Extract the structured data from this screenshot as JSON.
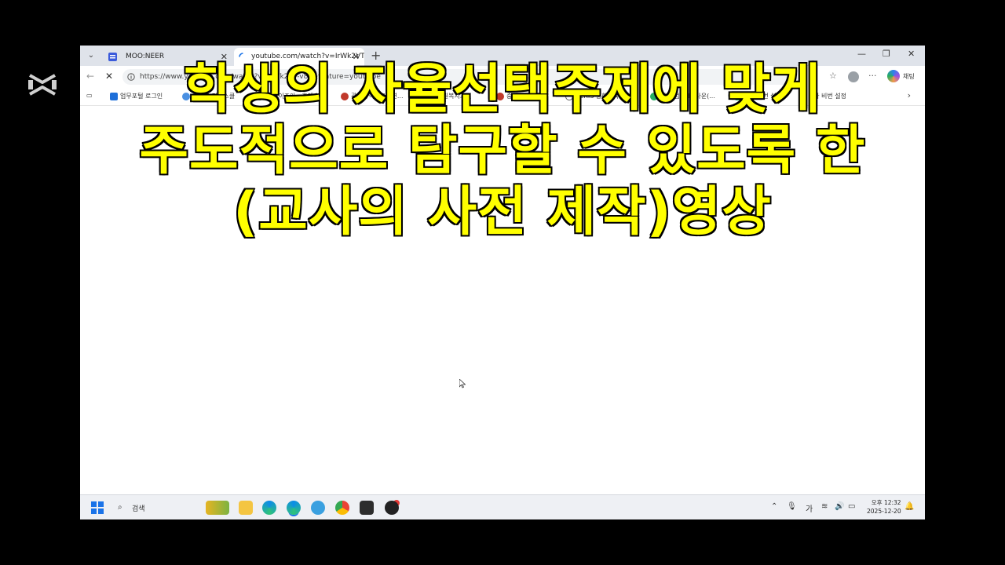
{
  "browser": {
    "tabs": [
      {
        "title": "MOO:NEER",
        "active": false
      },
      {
        "title": "youtube.com/watch?v=IrWk2VT-v",
        "active": true
      }
    ],
    "url": "https://www.youtube.com/watch?v=IrWk2VT-v8g&feature=youtu.be",
    "copilot_label": "채팅",
    "bookmarks": [
      {
        "label": "업무포털 로그인",
        "color": "#1e6fd9"
      },
      {
        "label": "운남고 리로스쿨",
        "color": "#4a90e2"
      },
      {
        "label": "㈜컴이조아 - 홈페...",
        "color": "#666666"
      },
      {
        "label": "광주광역시교육연...",
        "color": "#c0392b"
      },
      {
        "label": "공무원복지포털",
        "color": "#e74c3c"
      },
      {
        "label": "중앙교육연수원",
        "color": "#c0392b"
      },
      {
        "label": "KERIS 종합교육연...",
        "color": "#666666"
      },
      {
        "label": "첫 수업 자료 다운(...",
        "color": "#27ae60"
      },
      {
        "label": "2차 비번 설정",
        "color": "#2ecc71"
      },
      {
        "label": "1차 비번 설정",
        "color": "#2ecc71"
      }
    ]
  },
  "caption": {
    "lines": [
      "학생의 자율선택주제에 맞게",
      "주도적으로 탐구할 수 있도록 한",
      "(교사의 사전 제작)영상"
    ]
  },
  "taskbar": {
    "search_label": "검색",
    "ime_label": "가",
    "time": "오후 12:32",
    "date": "2025-12-20"
  },
  "colors": {
    "caption_fill": "#ffff00",
    "caption_stroke": "#000000",
    "tabbar": "#dfe3ea"
  }
}
